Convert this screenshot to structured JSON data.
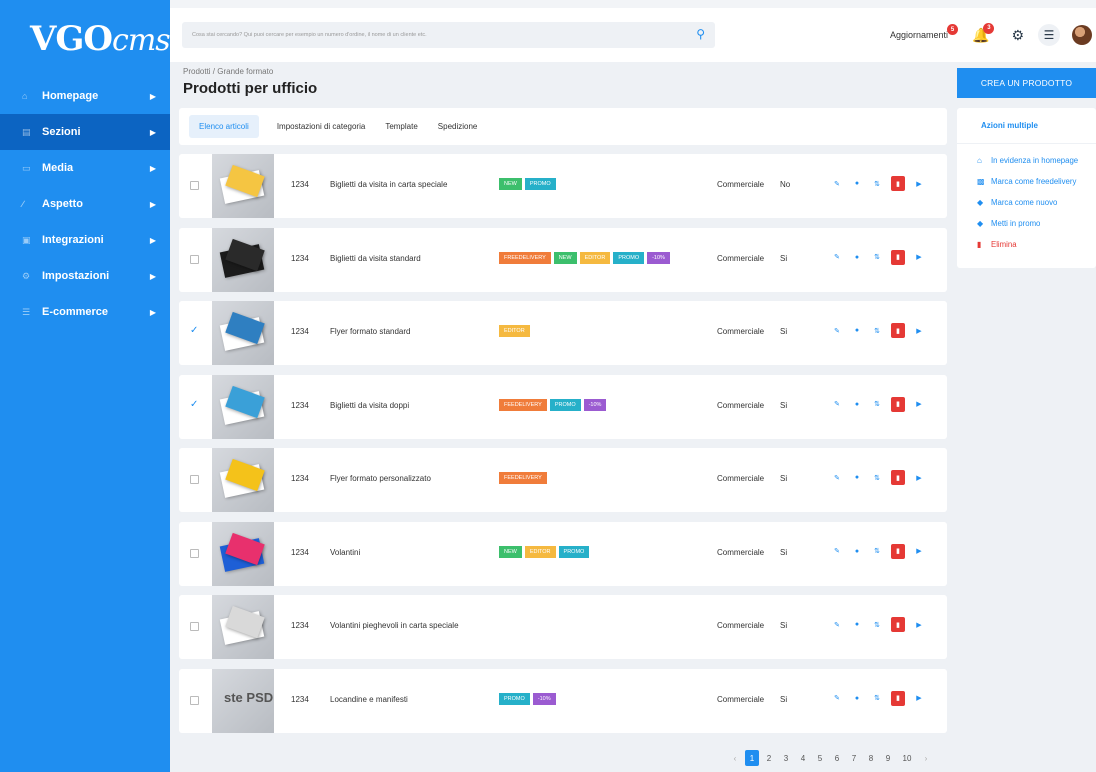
{
  "brand": {
    "logo_main": "VGO",
    "logo_sub": "cms"
  },
  "sidebar": {
    "items": [
      {
        "label": "Homepage",
        "icon": "home-icon",
        "active": false
      },
      {
        "label": "Sezioni",
        "icon": "sections-icon",
        "active": true
      },
      {
        "label": "Media",
        "icon": "media-icon",
        "active": false
      },
      {
        "label": "Aspetto",
        "icon": "brush-icon",
        "active": false
      },
      {
        "label": "Integrazioni",
        "icon": "integrations-icon",
        "active": false
      },
      {
        "label": "Impostazioni",
        "icon": "gear-icon",
        "active": false
      },
      {
        "label": "E-commerce",
        "icon": "cart-icon",
        "active": false
      }
    ]
  },
  "topbar": {
    "search_placeholder": "Cosa stai cercando? Qui puoi cercare per esempio un numero d'ordine, il nome di un cliente etc.",
    "updates_label": "Aggiornamenti",
    "updates_count": "5",
    "notifications_count": "3"
  },
  "page": {
    "breadcrumb": "Prodotti / Grande formato",
    "title": "Prodotti per ufficio",
    "create_label": "CREA UN PRODOTTO"
  },
  "tabs": [
    {
      "label": "Elenco articoli",
      "active": true
    },
    {
      "label": "Impostazioni di categoria",
      "active": false
    },
    {
      "label": "Template",
      "active": false
    },
    {
      "label": "Spedizione",
      "active": false
    }
  ],
  "bulk_actions": {
    "title": "Azioni multiple",
    "items": [
      {
        "label": "In evidenza in homepage",
        "icon": "home-icon"
      },
      {
        "label": "Marca come freedelivery",
        "icon": "truck-icon"
      },
      {
        "label": "Marca come nuovo",
        "icon": "tag-icon"
      },
      {
        "label": "Metti in promo",
        "icon": "tag-icon"
      },
      {
        "label": "Elimina",
        "icon": "trash-icon"
      }
    ]
  },
  "products": [
    {
      "code": "1234",
      "name": "Biglietti da visita in carta speciale",
      "tags": [
        "NEW",
        "PROMO"
      ],
      "category": "Commerciale",
      "flag": "No",
      "checked": false
    },
    {
      "code": "1234",
      "name": "Biglietti da visita standard",
      "tags": [
        "FREEDELIVERY",
        "NEW",
        "EDITOR",
        "PROMO",
        "-10%"
      ],
      "category": "Commerciale",
      "flag": "Si",
      "checked": false
    },
    {
      "code": "1234",
      "name": "Flyer formato standard",
      "tags": [
        "EDITOR"
      ],
      "category": "Commerciale",
      "flag": "Si",
      "checked": true
    },
    {
      "code": "1234",
      "name": "Biglietti da visita doppi",
      "tags": [
        "FEEDELIVERY",
        "PROMO",
        "-10%"
      ],
      "category": "Commerciale",
      "flag": "Si",
      "checked": true
    },
    {
      "code": "1234",
      "name": "Flyer formato personalizzato",
      "tags": [
        "FEEDELIVERY"
      ],
      "category": "Commerciale",
      "flag": "Si",
      "checked": false
    },
    {
      "code": "1234",
      "name": "Volantini",
      "tags": [
        "NEW",
        "EDITOR",
        "PROMO"
      ],
      "category": "Commerciale",
      "flag": "Si",
      "checked": false
    },
    {
      "code": "1234",
      "name": "Volantini pieghevoli in carta speciale",
      "tags": [],
      "category": "Commerciale",
      "flag": "Si",
      "checked": false
    },
    {
      "code": "1234",
      "name": "Locandine e manifesti",
      "tags": [
        "PROMO",
        "-10%"
      ],
      "category": "Commerciale",
      "flag": "Si",
      "checked": false,
      "thumb_text": "ste PSD"
    }
  ],
  "pagination": {
    "prev": "‹",
    "next": "›",
    "pages": [
      "1",
      "2",
      "3",
      "4",
      "5",
      "6",
      "7",
      "8",
      "9",
      "10"
    ],
    "current": "1"
  },
  "colors": {
    "primary": "#1f8ef0",
    "sidebar_active": "#0c64c2",
    "danger": "#e53935",
    "tag_new": "#3cbf6c",
    "tag_promo": "#26b0c9",
    "tag_freedelivery": "#f07c3a",
    "tag_editor": "#f5b940",
    "tag_discount": "#9b5bd1"
  }
}
